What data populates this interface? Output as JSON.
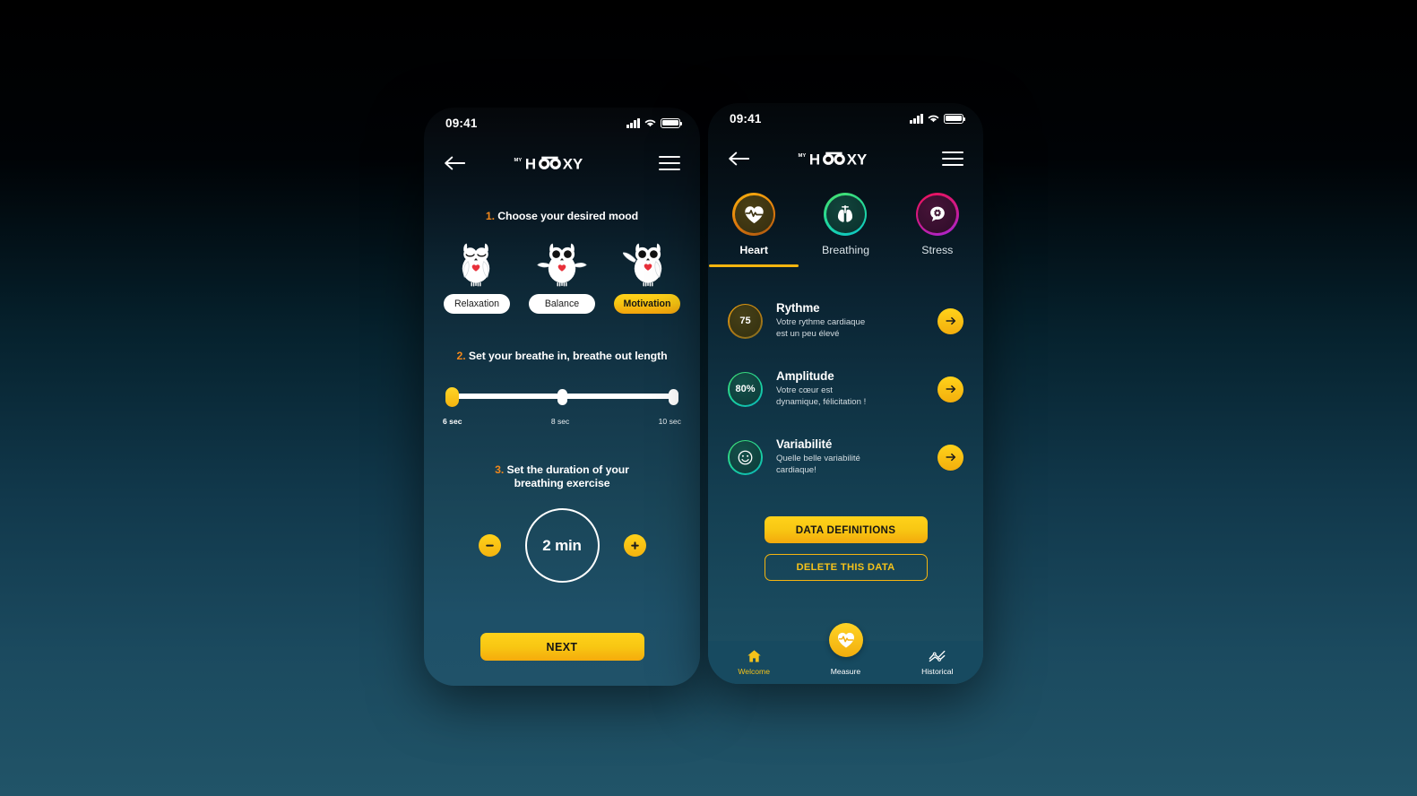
{
  "theme": {
    "accent_yellow": "#f5b50f",
    "accent_orange": "#f0871b",
    "page_bg_top": "#000000",
    "page_bg_bottom": "#215468"
  },
  "left_phone": {
    "status_bar": {
      "time": "09:41",
      "signal_icon": "signal-bars-icon",
      "wifi_icon": "wifi-icon",
      "battery_icon": "battery-icon"
    },
    "header": {
      "back_icon": "back-arrow-icon",
      "menu_icon": "hamburger-menu-icon",
      "logo_my": "MY",
      "logo_text_left": "H",
      "logo_text_right": "XY"
    },
    "step1": {
      "number": "1.",
      "title": "Choose your desired mood",
      "moods": [
        {
          "label": "Relaxation",
          "owl": "owl-eyes-closed-icon",
          "active": false
        },
        {
          "label": "Balance",
          "owl": "owl-wings-spread-icon",
          "active": false
        },
        {
          "label": "Motivation",
          "owl": "owl-wing-raised-icon",
          "active": true
        }
      ]
    },
    "step2": {
      "number": "2.",
      "title": "Set your breathe in, breathe out length",
      "selected_value": "6 sec",
      "ticks": [
        {
          "label": "6 sec",
          "selected": true
        },
        {
          "label": "8 sec",
          "selected": false
        },
        {
          "label": "10 sec",
          "selected": false
        }
      ]
    },
    "step3": {
      "number": "3.",
      "title_line1": "Set the duration of your",
      "title_line2": "breathing exercise",
      "decrease_label": "minus-icon",
      "increase_label": "plus-icon",
      "duration_value": "2 min"
    },
    "next_button": "NEXT"
  },
  "right_phone": {
    "status_bar": {
      "time": "09:41",
      "signal_icon": "signal-bars-icon",
      "wifi_icon": "wifi-icon",
      "battery_icon": "battery-icon"
    },
    "header": {
      "back_icon": "back-arrow-icon",
      "menu_icon": "hamburger-menu-icon",
      "logo_my": "MY",
      "logo_text_left": "H",
      "logo_text_right": "XY"
    },
    "tabs": [
      {
        "label": "Heart",
        "icon": "heart-pulse-icon",
        "active": true,
        "ring_from": "#f7a40d",
        "ring_to": "#c46a12",
        "fill": "#3d3a15"
      },
      {
        "label": "Breathing",
        "icon": "lungs-icon",
        "active": false,
        "ring_from": "#3ddc6a",
        "ring_to": "#0ec9a8",
        "fill": "#0d3b34"
      },
      {
        "label": "Stress",
        "icon": "brain-gear-icon",
        "active": false,
        "ring_from": "#e8125e",
        "ring_to": "#a221c9",
        "fill": "#3a0f33"
      }
    ],
    "metrics": [
      {
        "badge": "75",
        "badge_type": "text",
        "title": "Rythme",
        "desc_line1": "Votre rythme cardiaque",
        "desc_line2": "est un peu élevé",
        "ring_from": "#f1a00f",
        "ring_to": "#8f6a1c",
        "fill": "#3b3a1b",
        "arrow": "arrow-right-icon"
      },
      {
        "badge": "80%",
        "badge_type": "text",
        "title": "Amplitude",
        "desc_line1": "Votre cœur est",
        "desc_line2": "dynamique, félicitation !",
        "ring_from": "#3ddc6a",
        "ring_to": "#0cb9a6",
        "fill": "#11463f",
        "arrow": "arrow-right-icon"
      },
      {
        "badge": "smiley-face-icon",
        "badge_type": "icon",
        "title": "Variabilité",
        "desc_line1": "Quelle belle variabilité",
        "desc_line2": "cardiaque!",
        "ring_from": "#3ddc6a",
        "ring_to": "#0cb9a6",
        "fill": "#11463f",
        "arrow": "arrow-right-icon"
      }
    ],
    "data_definitions_button": "DATA DEFINITIONS",
    "delete_data_button": "DELETE THIS DATA",
    "bottom_nav": [
      {
        "label": "Welcome",
        "icon": "home-icon",
        "active": true
      },
      {
        "label": "Measure",
        "icon": "heart-pulse-icon",
        "active": false
      },
      {
        "label": "Historical",
        "icon": "line-chart-icon",
        "active": false
      }
    ]
  }
}
